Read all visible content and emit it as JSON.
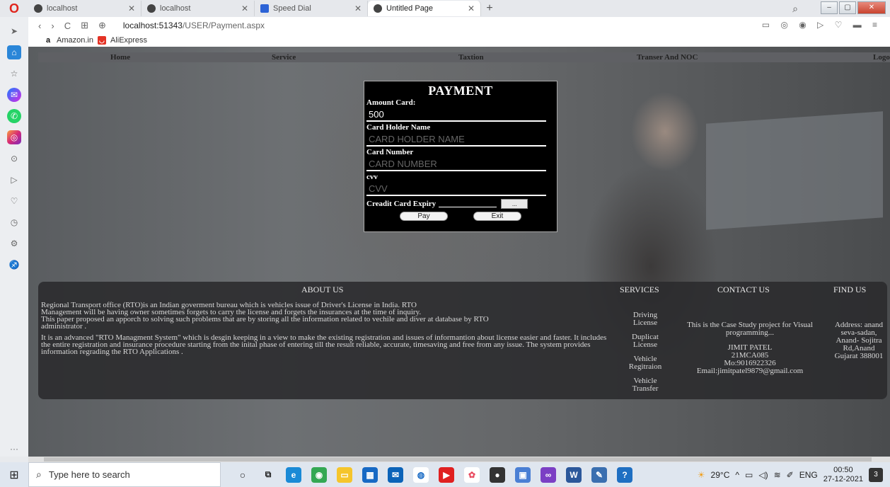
{
  "browser": {
    "tabs": [
      {
        "label": "localhost",
        "active": false
      },
      {
        "label": "localhost",
        "active": false
      },
      {
        "label": "Speed Dial",
        "active": false
      },
      {
        "label": "Untitled Page",
        "active": true
      }
    ],
    "new_tab": "+",
    "url_host": "localhost:51343",
    "url_path": "/USER/Payment.aspx",
    "bookmarks": [
      {
        "label": "Amazon.in",
        "icon": "amazon-icon"
      },
      {
        "label": "AliExpress",
        "icon": "aliexpress-icon"
      }
    ]
  },
  "menu": {
    "items": [
      "Home",
      "Service",
      "Taxtion",
      "Transer And NOC",
      "Logo"
    ]
  },
  "payment": {
    "title": "PAYMENT",
    "amount_label": "Amount Card:",
    "amount_value": "500",
    "holder_label": "Card Holder Name",
    "holder_placeholder": "CARD HOLDER NAME",
    "number_label": "Card Number",
    "number_placeholder": "CARD NUMBER",
    "cvv_label": "cvv",
    "cvv_placeholder": "CVV",
    "expiry_label": "Creadit Card Expiry",
    "calendar_button": "...",
    "pay_button": "Pay",
    "exit_button": "Exit"
  },
  "footer": {
    "about_heading": "ABOUT US",
    "services_heading": "SERVICES",
    "contact_heading": "CONTACT US",
    "find_heading": "FIND US",
    "about_p1": "Regional Transport office (RTO)is an Indian goverment bureau which is vehicles issue of Driver's License in India. RTO",
    "about_p2": "Management will be having owner sometimes forgets to carry the license and forgets the insurances at the time of inquiry.",
    "about_p3": "This paper proposed an apporch to solving such problems that are by storing all the information related to vechile and diver at database by RTO administrator .",
    "about_p4": "It is an advanced \"RTO Managment System\" which is desgin keeping in a view to make the existing registration and issues of informantion about license easier and faster. It includes the entire registration and insurance procedure starting from the inital phase of entering till the result reliable, accurate, timesaving and free from any issue. The system provides information regrading the RTO Applications .",
    "services": [
      "Driving License",
      "Duplicat License",
      "Vehicle Regitraion",
      "Vehicle Transfer"
    ],
    "contact_line1": "This is the Case Study project for Visual programming...",
    "contact_name": "JIMIT PATEL",
    "contact_id": "21MCA085",
    "contact_mobile": "Mo:9016922326",
    "contact_email": "Email:jimitpatel9879@gmail.com",
    "find_text": "Address: anand seva-sadan, Anand- Sojitra Rd,Anand Gujarat 388001"
  },
  "taskbar": {
    "search_placeholder": "Type here to search",
    "weather": "29°C",
    "language": "ENG",
    "time": "00:50",
    "date": "27-12-2021",
    "notifications": "3"
  }
}
